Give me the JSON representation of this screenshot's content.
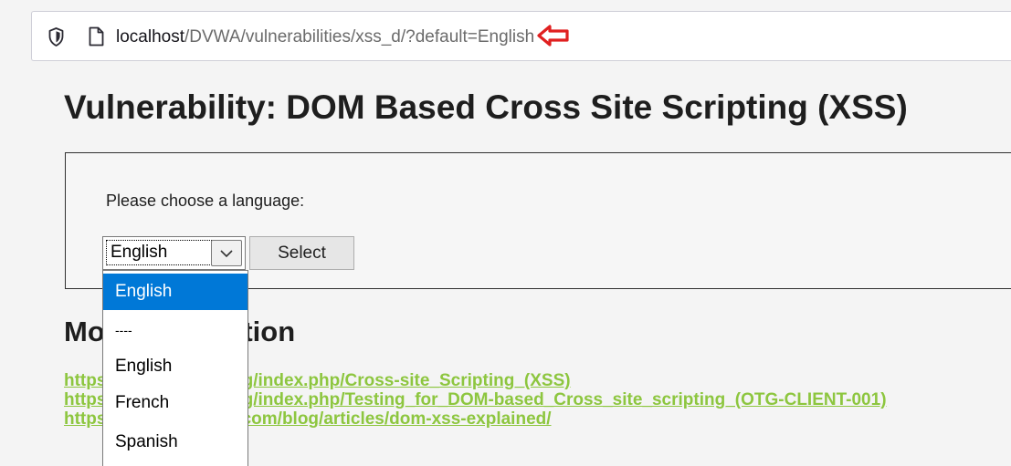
{
  "browser": {
    "url_host": "localhost",
    "url_path": "/DVWA/vulnerabilities/xss_d/?default=English",
    "annotation_arrow_color": "#e02020"
  },
  "page": {
    "title": "Vulnerability: DOM Based Cross Site Scripting (XSS)",
    "language_prompt": "Please choose a language:",
    "select_value": "English",
    "select_button": "Select",
    "more_info_heading": "More Information",
    "links": [
      "https://www.owasp.org/index.php/Cross-site_Scripting_(XSS)",
      "https://www.owasp.org/index.php/Testing_for_DOM-based_Cross_site_scripting_(OTG-CLIENT-001)",
      "https://www.acunetix.com/blog/articles/dom-xss-explained/"
    ],
    "link_color": "#8dc63f"
  },
  "dropdown": {
    "options": [
      "English",
      "----",
      "English",
      "French",
      "Spanish"
    ],
    "highlighted_index": 0,
    "highlight_color": "#0078d7"
  }
}
